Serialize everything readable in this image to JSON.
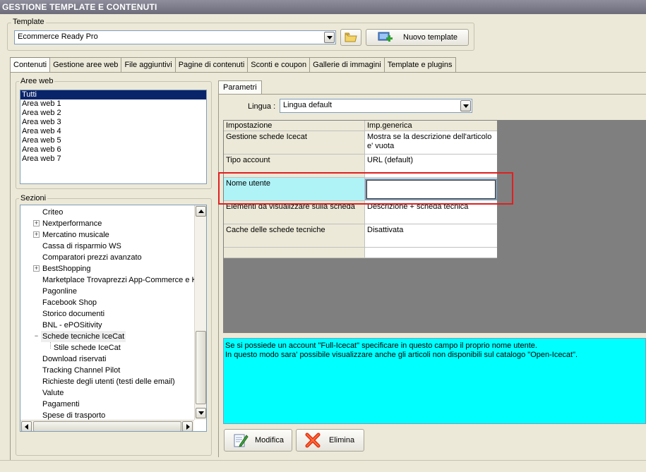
{
  "window": {
    "title": "GESTIONE TEMPLATE E CONTENUTI"
  },
  "template_group": {
    "label": "Template",
    "selected": "Ecommerce Ready Pro",
    "new_button": "Nuovo template"
  },
  "tabs": [
    {
      "label": "Contenuti",
      "active": true
    },
    {
      "label": "Gestione aree web"
    },
    {
      "label": "File aggiuntivi"
    },
    {
      "label": "Pagine di contenuti"
    },
    {
      "label": "Sconti e coupon"
    },
    {
      "label": "Gallerie di immagini"
    },
    {
      "label": "Template e plugins"
    }
  ],
  "aree_web": {
    "label": "Aree web",
    "items": [
      "Tutti",
      "Area web 1",
      "Area web 2",
      "Area web 3",
      "Area web 4",
      "Area web 5",
      "Area web 6",
      "Area web 7"
    ]
  },
  "sezioni": {
    "label": "Sezioni",
    "items": [
      {
        "label": "Criteo"
      },
      {
        "label": "Nextperformance"
      },
      {
        "label": "Mercatino musicale"
      },
      {
        "label": "Cassa di risparmio WS"
      },
      {
        "label": "Comparatori prezzi avanzato"
      },
      {
        "label": "BestShopping"
      },
      {
        "label": "Marketplace Trovaprezzi App-Commerce e Ki"
      },
      {
        "label": "Pagonline"
      },
      {
        "label": "Facebook Shop"
      },
      {
        "label": "Storico documenti"
      },
      {
        "label": "BNL - ePOSitivity"
      },
      {
        "label": "Schede tecniche IceCat"
      },
      {
        "label": "Stile schede IceCat"
      },
      {
        "label": "Download riservati"
      },
      {
        "label": "Tracking Channel Pilot"
      },
      {
        "label": "Richieste degli utenti (testi delle email)"
      },
      {
        "label": "Valute"
      },
      {
        "label": "Pagamenti"
      },
      {
        "label": "Spese di trasporto"
      }
    ]
  },
  "parametri": {
    "tab_label": "Parametri",
    "lingua_label": "Lingua :",
    "lingua_value": "Lingua default",
    "grid": {
      "col_setting": "Impostazione",
      "col_value": "Imp.generica",
      "rows": [
        {
          "setting": "Gestione schede Icecat",
          "value": "Mostra se la descrizione dell'articolo e' vuota"
        },
        {
          "setting": "Tipo account",
          "value": "URL (default)"
        },
        {
          "setting": "Nome utente",
          "value": ""
        },
        {
          "setting": "Elementi da visualizzare sulla scheda",
          "value": "Descrizione + scheda tecnica"
        },
        {
          "setting": "Cache delle schede tecniche",
          "value": "Disattivata"
        },
        {
          "setting": "",
          "value": ""
        }
      ]
    },
    "help_text": [
      "Se si possiede un account \"Full-Icecat\" specificare in questo campo il proprio nome utente.",
      "In questo modo sara' possibile visualizzare anche gli articoli non disponibili sul catalogo \"Open-Icecat\"."
    ]
  },
  "actions": {
    "modifica": "Modifica",
    "elimina": "Elimina"
  },
  "colors": {
    "help_bg": "#00ffff",
    "highlight": "#e02020",
    "selected_row": "#aff3f7",
    "list_selection": "#0a246a"
  }
}
